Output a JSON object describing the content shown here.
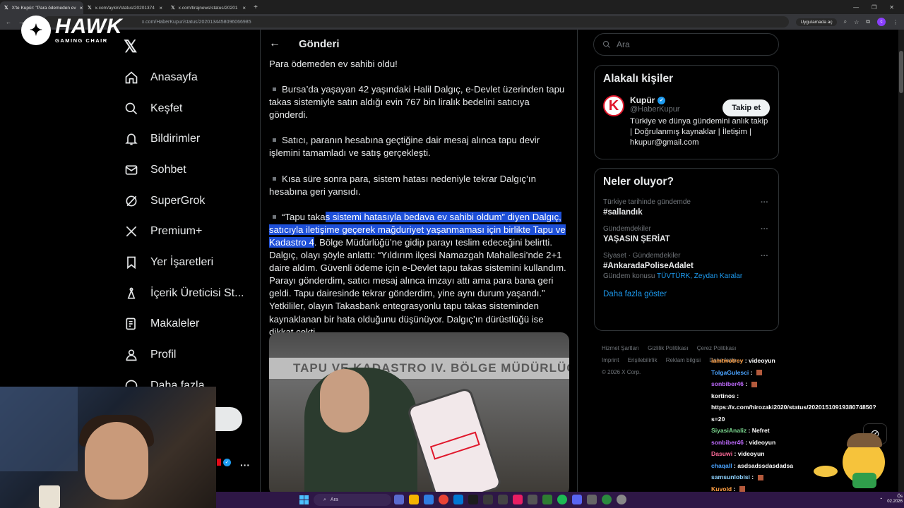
{
  "browser": {
    "tabs": [
      {
        "title": "X'te Kupür: \"Para ödemeden ev",
        "active": true
      },
      {
        "title": "x.com/aykiri/status/20201374",
        "active": false
      },
      {
        "title": "x.com/tirajnews/status/20201",
        "active": false
      }
    ],
    "url": "x.com/HaberKupur/status/2020134458096066985",
    "app_chip": "Uygulamada aç",
    "profile_letter": "c"
  },
  "overlay_logo": {
    "brand": "HAWK",
    "sub": "GAMING CHAIR"
  },
  "nav": {
    "items": [
      {
        "label": "Anasayfa",
        "icon": "home-icon"
      },
      {
        "label": "Keşfet",
        "icon": "search-icon"
      },
      {
        "label": "Bildirimler",
        "icon": "bell-icon"
      },
      {
        "label": "Sohbet",
        "icon": "mail-icon"
      },
      {
        "label": "SuperGrok",
        "icon": "grok-icon"
      },
      {
        "label": "Premium+",
        "icon": "x-icon"
      },
      {
        "label": "Yer İşaretleri",
        "icon": "bookmark-icon"
      },
      {
        "label": "İçerik Üreticisi St...",
        "icon": "creator-icon"
      },
      {
        "label": "Makaleler",
        "icon": "article-icon"
      },
      {
        "label": "Profil",
        "icon": "person-icon"
      },
      {
        "label": "Daha fazla",
        "icon": "more-circle-icon"
      }
    ]
  },
  "post": {
    "header": "Gönderi",
    "lead": "Para ödemeden ev sahibi oldu!",
    "p1": "Bursa’da yaşayan 42 yaşındaki Halil Dalgıç, e-Devlet üzerinden tapu takas sistemiyle satın aldığı evin 767 bin liralık bedelini satıcıya gönderdi.",
    "p2": "Satıcı, paranın hesabına geçtiğine dair mesaj alınca tapu devir işlemini tamamladı ve satış gerçekleşti.",
    "p3": "Kısa süre sonra para, sistem hatası nedeniyle tekrar Dalgıç’ın hesabına geri yansıdı.",
    "p4_pre": "“Tapu taka",
    "p4_hl": "s sistemi hatasıyla bedava ev sahibi oldum” diyen Dalgıç, satıcıyla iletişime geçerek mağduriyet yaşanmaması için birlikte Tapu ve Kadastro 4",
    "p4_post": ". Bölge Müdürlüğü’ne gidip parayı teslim edeceğini belirtti. Dalgıç, olayı şöyle anlattı: “Yıldırım ilçesi Namazgah Mahallesi’nde 2+1 daire aldım. Güvenli ödeme için e-Devlet tapu takas sistemini kullandım. Parayı gönderdim, satıcı mesaj alınca imzayı attı ama para bana geri geldi. Tapu dairesinde tekrar gönderdim, yine aynı durum yaşandı.” Yetkililer, olayın Takasbank entegrasyonlu tapu takas sisteminden kaynaklanan bir hata olduğunu düşünüyor. Dalgıç’ın dürüstlüğü ise dikkat çekti.",
    "image_sign": "TAPU VE KADASTRO IV. BÖLGE MÜDÜRLÜĞ"
  },
  "sidebar": {
    "search_placeholder": "Ara",
    "related_title": "Alakalı kişiler",
    "related": {
      "name": "Kupür",
      "handle": "@HaberKupur",
      "bio": "Türkiye ve dünya gündemini anlık takip | Doğrulanmış kaynaklar | İletişim | hkupur@gmail.com",
      "follow": "Takip et"
    },
    "trends_title": "Neler oluyor?",
    "trends": [
      {
        "context": "Türkiye tarihinde gündemde",
        "name": "#sallandık",
        "sub_pre": "",
        "sub_link": ""
      },
      {
        "context": "Gündemdekiler",
        "name": "YAŞASIN ŞERİAT",
        "sub_pre": "",
        "sub_link": ""
      },
      {
        "context": "Siyaset · Gündemdekiler",
        "name": "#AnkaradaPoliseAdalet",
        "sub_pre": "Gündem konusu",
        "sub_link": "TÜVTÜRK, Zeydan Karalar"
      }
    ],
    "show_more": "Daha fazla göster",
    "footer": [
      "Hizmet Şartları",
      "Gizlilik Politikası",
      "Çerez Politikası",
      "Imprint",
      "Erişilebilirlik",
      "Reklam bilgisi",
      "Daha fazla ...",
      "© 2026 X Corp."
    ]
  },
  "chat": [
    {
      "user": "iamtwotrey",
      "color": "#ff9f43",
      "msg": "videoyun",
      "badge": false
    },
    {
      "user": "TolgaGulesci",
      "color": "#4aa3ff",
      "msg": "",
      "badge": true
    },
    {
      "user": "sonbiber46",
      "color": "#c06bff",
      "msg": "",
      "badge": true
    },
    {
      "user": "kortinos",
      "color": "#ffffff",
      "msg": "",
      "badge": false
    },
    {
      "user": "",
      "color": "#ffffff",
      "msg": "https://x.com/hirozaki2020/status/2020151091938074850?",
      "badge": false
    },
    {
      "user": "",
      "color": "#ffffff",
      "msg": "s=20",
      "badge": false
    },
    {
      "user": "SiyasiAnaliz",
      "color": "#7bd88f",
      "msg": "Nefret",
      "badge": false
    },
    {
      "user": "sonbiber46",
      "color": "#c06bff",
      "msg": "videoyun",
      "badge": false
    },
    {
      "user": "Dasuwi",
      "color": "#ff6b9a",
      "msg": "videoyun",
      "badge": false
    },
    {
      "user": "chaqall",
      "color": "#4aa3ff",
      "msg": "asdsadssdasdadsa",
      "badge": false
    },
    {
      "user": "samsunlobisi",
      "color": "#8fd3ff",
      "msg": "",
      "badge": true
    },
    {
      "user": "Kuvold",
      "color": "#ff9f43",
      "msg": "",
      "badge": true
    }
  ],
  "taskbar": {
    "search": "Ara",
    "time": "Ös",
    "date": "02.2026"
  }
}
